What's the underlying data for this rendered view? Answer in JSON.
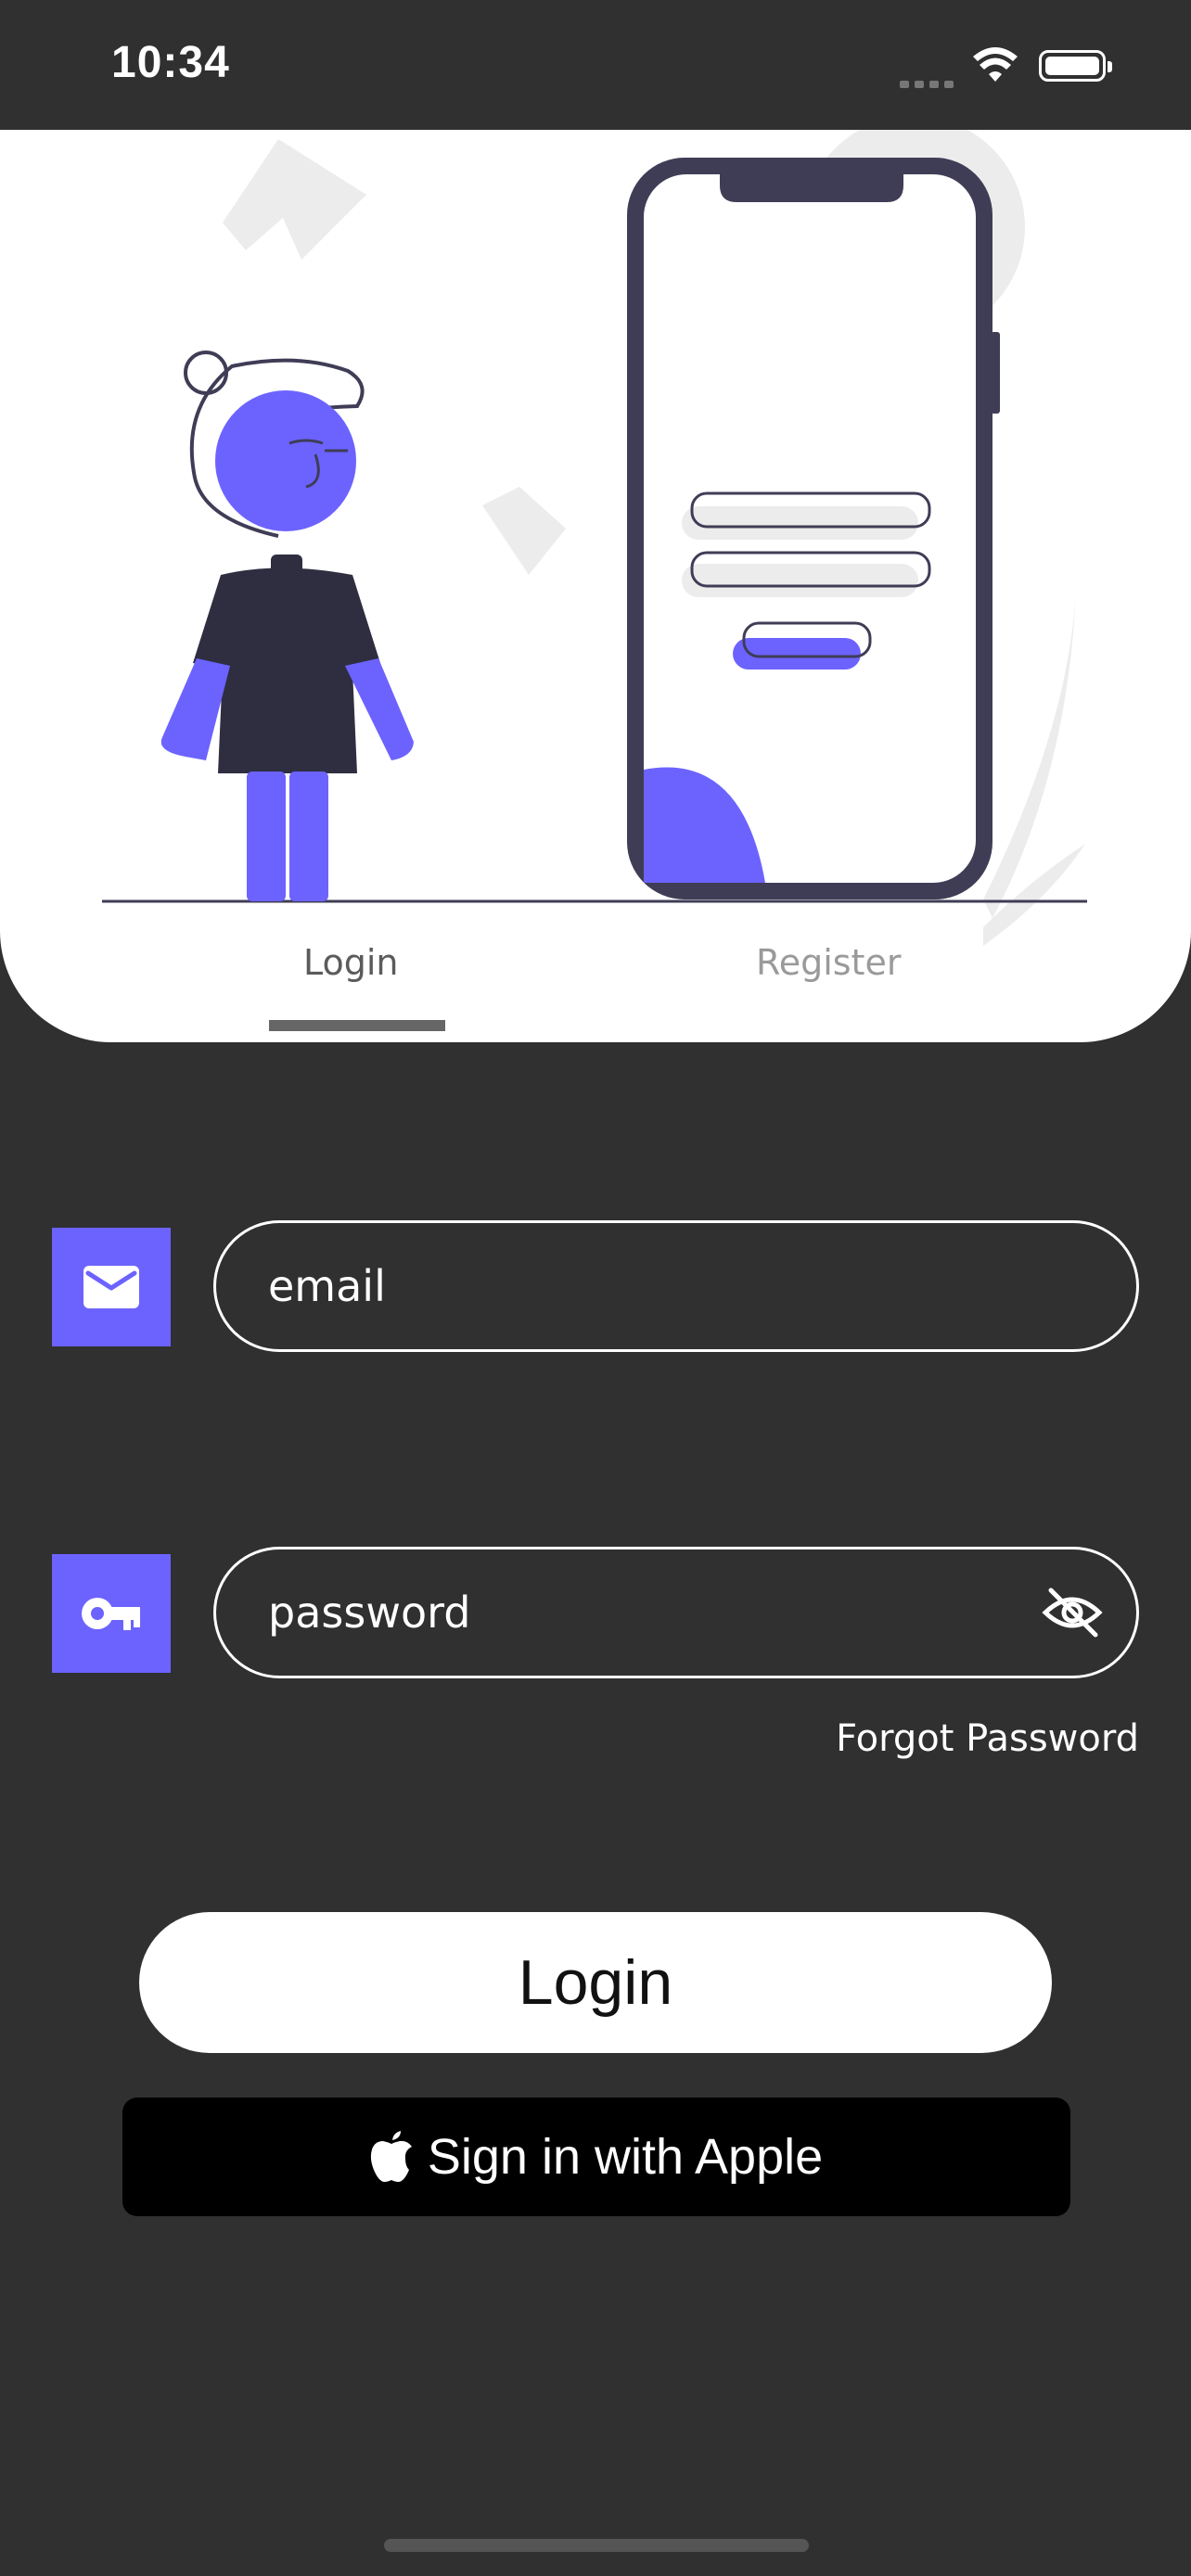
{
  "status_bar": {
    "time": "10:34"
  },
  "tabs": [
    {
      "label": "Login",
      "active": true
    },
    {
      "label": "Register",
      "active": false
    }
  ],
  "form": {
    "email": {
      "placeholder": "email",
      "value": ""
    },
    "password": {
      "placeholder": "password",
      "value": ""
    },
    "forgot_password_label": "Forgot Password"
  },
  "actions": {
    "login_label": "Login",
    "apple_label": "Sign in with Apple"
  },
  "icons": {
    "email": "mail-icon",
    "password": "key-icon",
    "visibility": "eye-off-icon",
    "apple": "apple-icon"
  },
  "colors": {
    "accent": "#6c63ff",
    "background": "#303030",
    "illustration_dark": "#3f3d56",
    "surface": "#ffffff"
  }
}
